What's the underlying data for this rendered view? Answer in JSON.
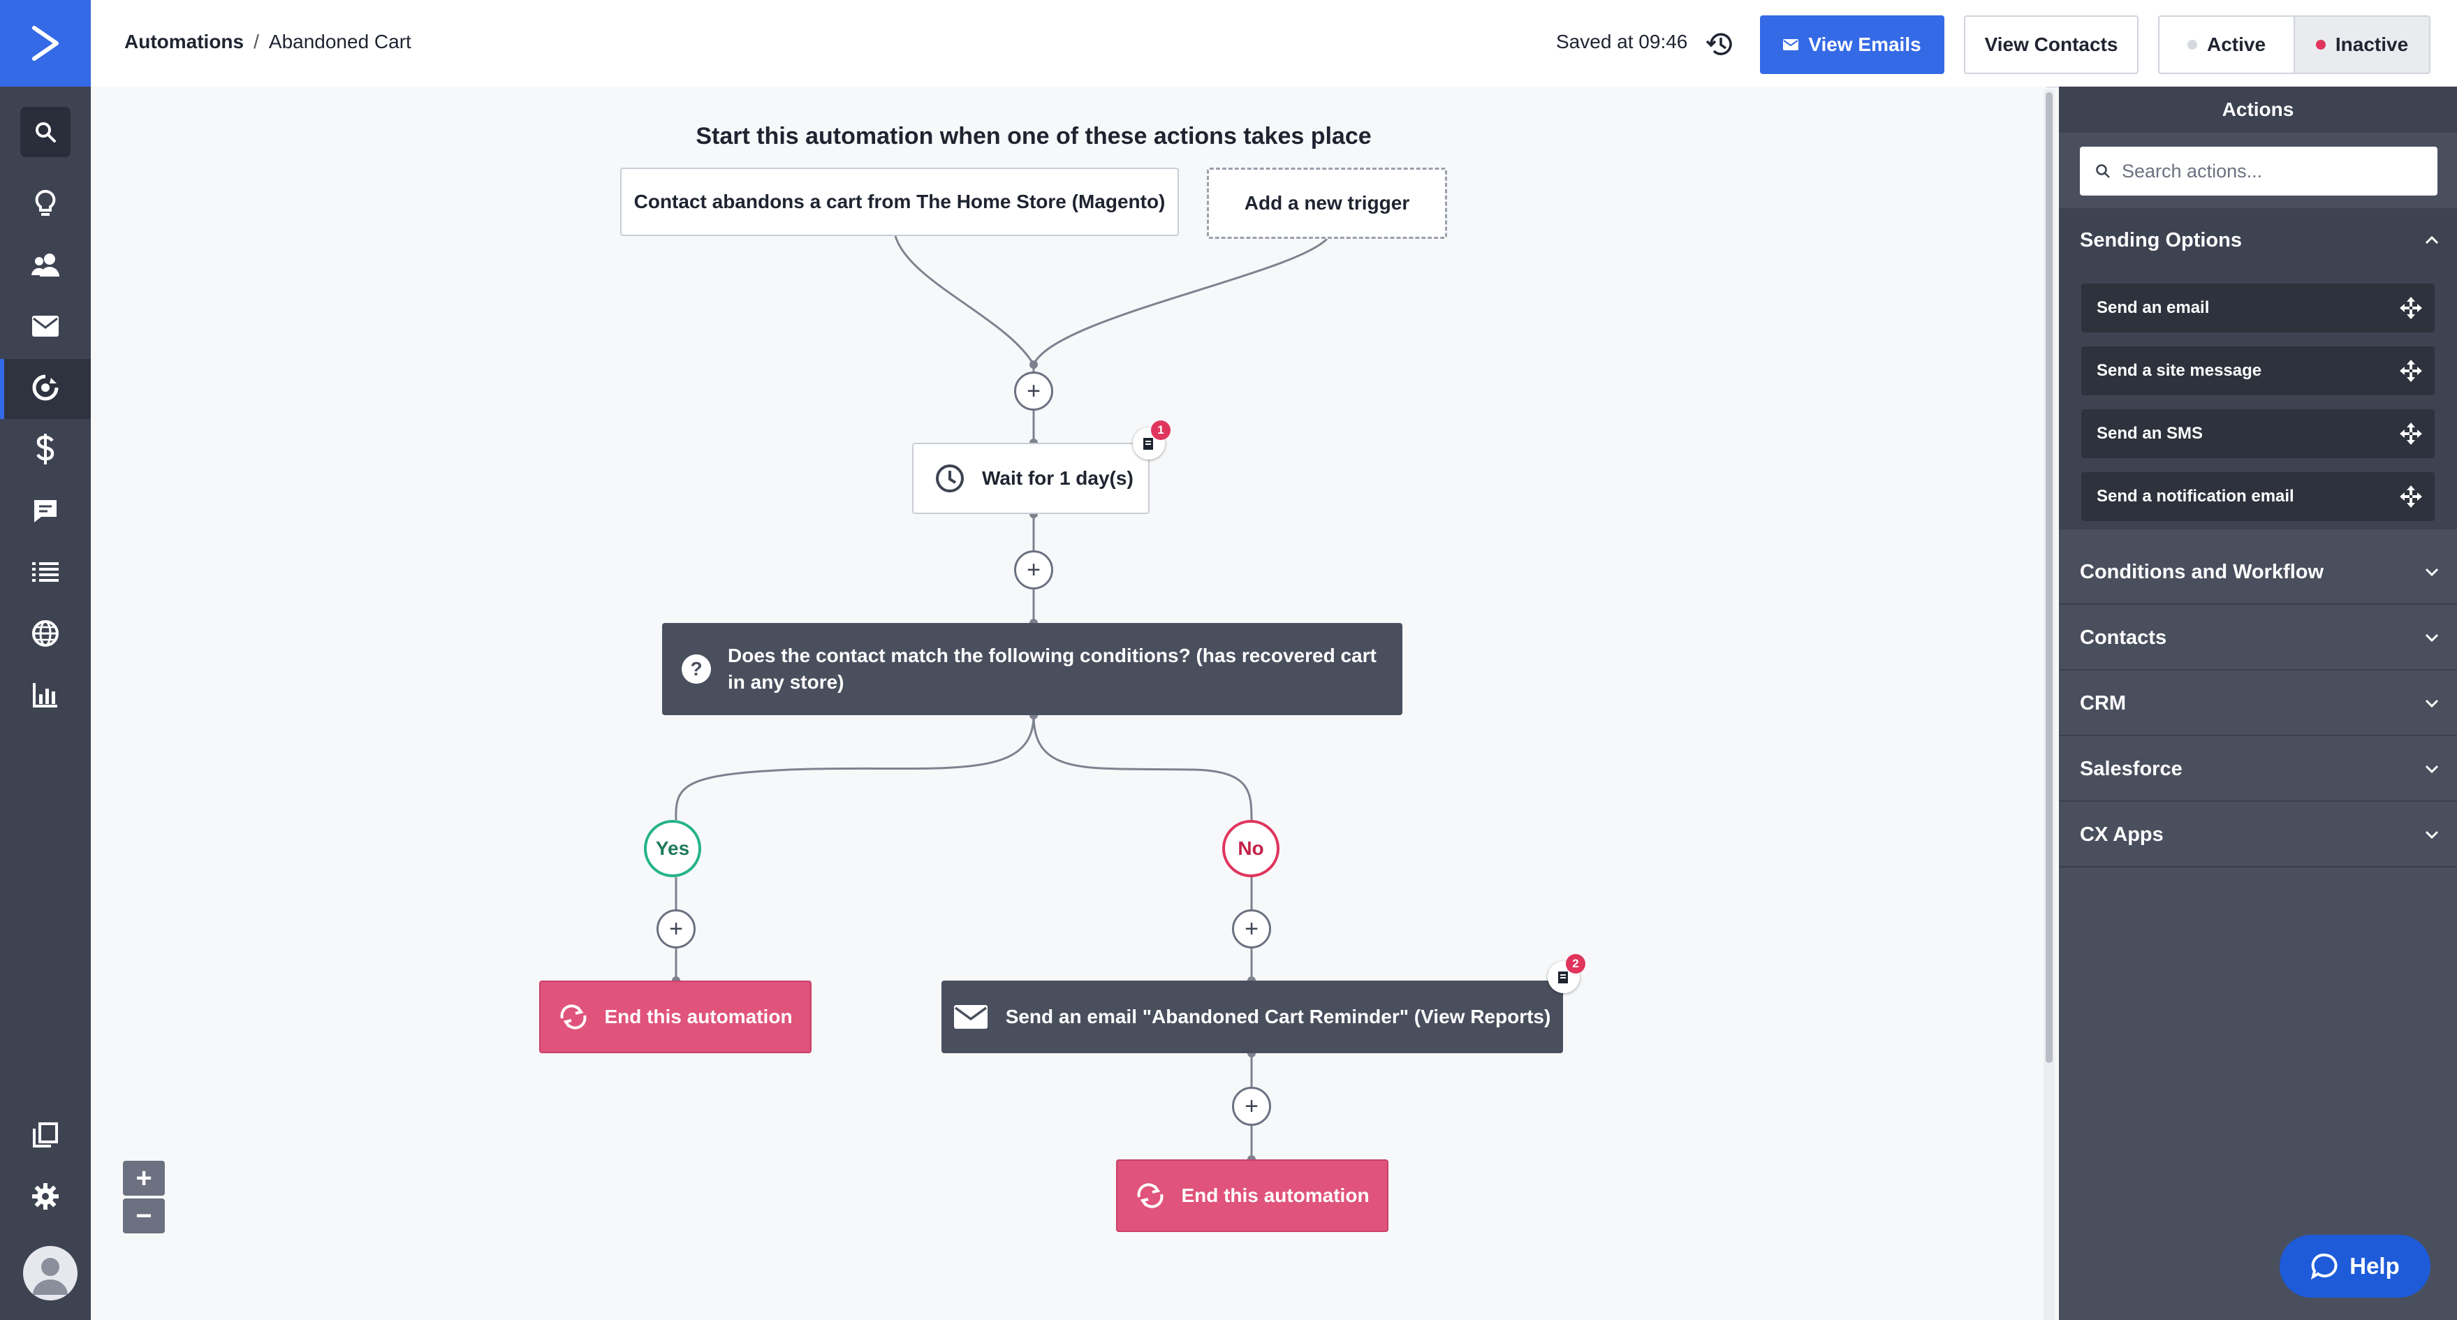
{
  "breadcrumb": {
    "root": "Automations",
    "separator": "/",
    "current": "Abandoned Cart"
  },
  "header": {
    "saved_text": "Saved at 09:46",
    "view_emails": "View Emails",
    "view_contacts": "View Contacts",
    "status_active": "Active",
    "status_inactive": "Inactive",
    "selected_status": "Inactive"
  },
  "colors": {
    "brand_blue": "#356ae6",
    "nav_bg": "#3e4352",
    "end_pink": "#e0537a",
    "yes_green": "#26b38a",
    "no_red": "#e0355d",
    "dark_node": "#4a4f5e"
  },
  "nav": {
    "icons": [
      "logo-chevron-icon",
      "search-icon",
      "lightbulb-icon",
      "contacts-icon",
      "email-icon",
      "automations-icon",
      "deals-dollar-icon",
      "conversations-icon",
      "lists-icon",
      "website-globe-icon",
      "reports-chart-icon",
      "pages-icon",
      "settings-gear-icon",
      "user-avatar-icon"
    ],
    "active": "automations-icon"
  },
  "canvas": {
    "heading": "Start this automation when one of these actions takes place",
    "trigger": "Contact abandons a cart from The Home Store (Magento)",
    "add_trigger": "Add a new trigger",
    "wait": "Wait for 1 day(s)",
    "wait_note_count": "1",
    "condition": "Does the contact match the following conditions? (has recovered cart in any store)",
    "condition_icon": "?",
    "yes_label": "Yes",
    "no_label": "No",
    "end_yes": "End this automation",
    "send_email": "Send an email \"Abandoned Cart Reminder\" (View Reports)",
    "send_note_count": "2",
    "end_no": "End this automation",
    "plus_symbol": "+",
    "zoom_in": "+",
    "zoom_out": "−"
  },
  "panel": {
    "title": "Actions",
    "search_placeholder": "Search actions...",
    "sections": [
      {
        "label": "Sending Options",
        "expanded": true,
        "items": [
          "Send an email",
          "Send a site message",
          "Send an SMS",
          "Send a notification email"
        ]
      },
      {
        "label": "Conditions and Workflow",
        "expanded": false
      },
      {
        "label": "Contacts",
        "expanded": false
      },
      {
        "label": "CRM",
        "expanded": false
      },
      {
        "label": "Salesforce",
        "expanded": false
      },
      {
        "label": "CX Apps",
        "expanded": false
      }
    ]
  },
  "help": {
    "label": "Help"
  }
}
